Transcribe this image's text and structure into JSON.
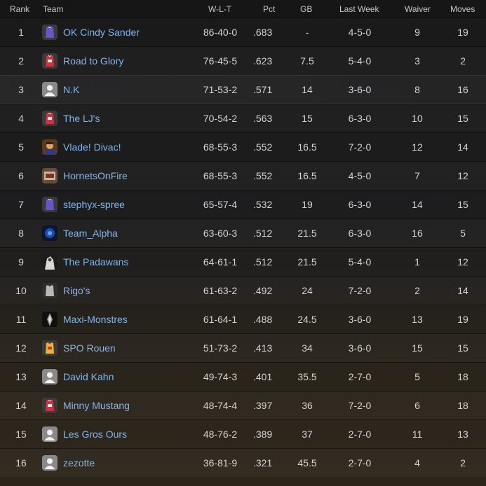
{
  "header": {
    "rank": "Rank",
    "team": "Team",
    "wlt": "W-L-T",
    "pct": "Pct",
    "gb": "GB",
    "last_week": "Last Week",
    "waiver": "Waiver",
    "moves": "Moves"
  },
  "rows": [
    {
      "rank": "1",
      "team": "OK Cindy Sander",
      "wlt": "86-40-0",
      "pct": ".683",
      "gb": "-",
      "last_week": "4-5-0",
      "waiver": "9",
      "moves": "19",
      "avatar": "jersey-purple-icon"
    },
    {
      "rank": "2",
      "team": "Road to Glory",
      "wlt": "76-45-5",
      "pct": ".623",
      "gb": "7.5",
      "last_week": "5-4-0",
      "waiver": "3",
      "moves": "2",
      "avatar": "jersey-red-icon"
    },
    {
      "rank": "3",
      "team": "N.K",
      "wlt": "71-53-2",
      "pct": ".571",
      "gb": "14",
      "last_week": "3-6-0",
      "waiver": "8",
      "moves": "16",
      "avatar": "default-user-icon"
    },
    {
      "rank": "4",
      "team": "The LJ's",
      "wlt": "70-54-2",
      "pct": ".563",
      "gb": "15",
      "last_week": "6-3-0",
      "waiver": "10",
      "moves": "15",
      "avatar": "jersey-red-icon"
    },
    {
      "rank": "5",
      "team": "Vlade! Divac!",
      "wlt": "68-55-3",
      "pct": ".552",
      "gb": "16.5",
      "last_week": "7-2-0",
      "waiver": "12",
      "moves": "14",
      "avatar": "photo-portrait-icon"
    },
    {
      "rank": "6",
      "team": "HornetsOnFire",
      "wlt": "68-55-3",
      "pct": ".552",
      "gb": "16.5",
      "last_week": "4-5-0",
      "waiver": "7",
      "moves": "12",
      "avatar": "photo-logo-icon"
    },
    {
      "rank": "7",
      "team": "stephyx-spree",
      "wlt": "65-57-4",
      "pct": ".532",
      "gb": "19",
      "last_week": "6-3-0",
      "waiver": "14",
      "moves": "15",
      "avatar": "jersey-purple-icon"
    },
    {
      "rank": "8",
      "team": "Team_Alpha",
      "wlt": "63-60-3",
      "pct": ".512",
      "gb": "21.5",
      "last_week": "6-3-0",
      "waiver": "16",
      "moves": "5",
      "avatar": "photo-blue-icon"
    },
    {
      "rank": "9",
      "team": "The Padawans",
      "wlt": "64-61-1",
      "pct": ".512",
      "gb": "21.5",
      "last_week": "5-4-0",
      "waiver": "1",
      "moves": "12",
      "avatar": "photo-bw-icon"
    },
    {
      "rank": "10",
      "team": "Rigo's",
      "wlt": "61-63-2",
      "pct": ".492",
      "gb": "24",
      "last_week": "7-2-0",
      "waiver": "2",
      "moves": "14",
      "avatar": "jersey-grey-icon"
    },
    {
      "rank": "11",
      "team": "Maxi-Monstres",
      "wlt": "61-64-1",
      "pct": ".488",
      "gb": "24.5",
      "last_week": "3-6-0",
      "waiver": "13",
      "moves": "19",
      "avatar": "photo-dark-icon"
    },
    {
      "rank": "12",
      "team": "SPO Rouen",
      "wlt": "51-73-2",
      "pct": ".413",
      "gb": "34",
      "last_week": "3-6-0",
      "waiver": "15",
      "moves": "15",
      "avatar": "jersey-yellow-icon"
    },
    {
      "rank": "13",
      "team": "David Kahn",
      "wlt": "49-74-3",
      "pct": ".401",
      "gb": "35.5",
      "last_week": "2-7-0",
      "waiver": "5",
      "moves": "18",
      "avatar": "default-user-icon"
    },
    {
      "rank": "14",
      "team": "Minny Mustang",
      "wlt": "48-74-4",
      "pct": ".397",
      "gb": "36",
      "last_week": "7-2-0",
      "waiver": "6",
      "moves": "18",
      "avatar": "jersey-red-icon"
    },
    {
      "rank": "15",
      "team": "Les Gros Ours",
      "wlt": "48-76-2",
      "pct": ".389",
      "gb": "37",
      "last_week": "2-7-0",
      "waiver": "11",
      "moves": "13",
      "avatar": "default-user-icon"
    },
    {
      "rank": "16",
      "team": "zezotte",
      "wlt": "36-81-9",
      "pct": ".321",
      "gb": "45.5",
      "last_week": "2-7-0",
      "waiver": "4",
      "moves": "2",
      "avatar": "default-user-icon"
    }
  ],
  "highlighted_rank": "3",
  "colors": {
    "team_link": "#7fb6ee",
    "text": "#d4d4d4",
    "background": "#1a1a1b"
  }
}
